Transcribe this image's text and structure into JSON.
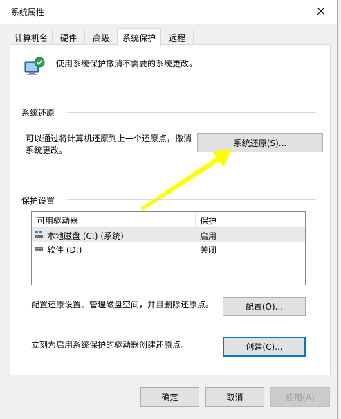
{
  "window": {
    "title": "系统属性"
  },
  "tabs": [
    {
      "label": "计算机名"
    },
    {
      "label": "硬件"
    },
    {
      "label": "高级"
    },
    {
      "label": "系统保护",
      "active": true
    },
    {
      "label": "远程"
    }
  ],
  "header": {
    "description": "使用系统保护撤消不需要的系统更改。"
  },
  "restore": {
    "group_title": "系统还原",
    "text_line1": "可以通过将计算机还原到上一个还原点，撤消",
    "text_line2": "系统更改。",
    "button": "系统还原(S)..."
  },
  "protection": {
    "group_title": "保护设置",
    "columns": [
      "可用驱动器",
      "保护"
    ],
    "rows": [
      {
        "drive": "本地磁盘 (C:) (系统)",
        "status": "启用",
        "icon": "system-drive-icon"
      },
      {
        "drive": "软件 (D:)",
        "status": "关闭",
        "icon": "drive-icon"
      }
    ],
    "configure_text": "配置还原设置、管理磁盘空间，并且删除还原点。",
    "configure_button": "配置(O)...",
    "create_text": "立刻为启用系统保护的驱动器创建还原点。",
    "create_button": "创建(C)..."
  },
  "footer": {
    "ok": "确定",
    "cancel": "取消",
    "apply": "应用(A)"
  },
  "colors": {
    "accent": "#0078d7",
    "arrow": "#ffff00"
  }
}
